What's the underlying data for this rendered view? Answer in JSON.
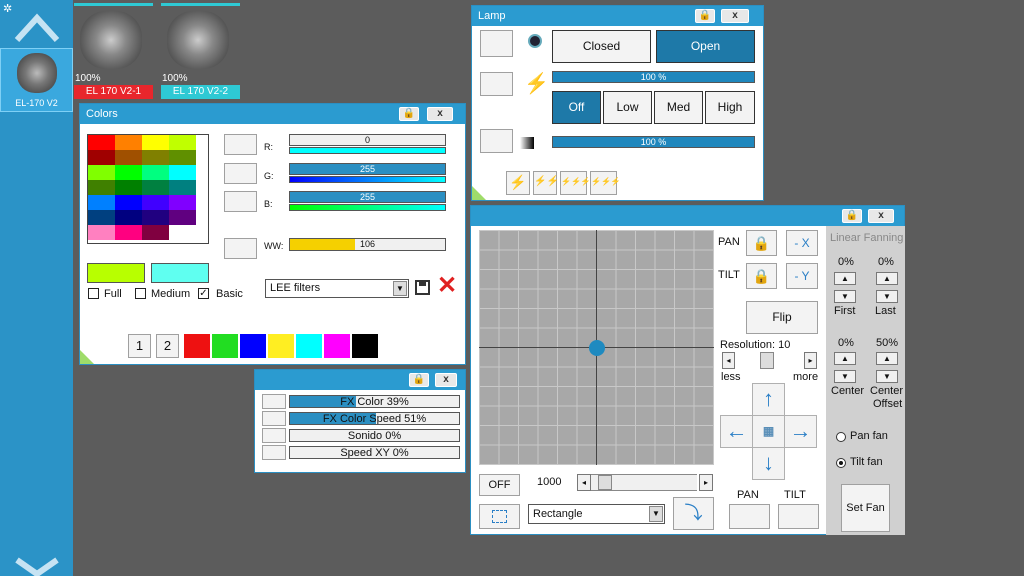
{
  "sidebar": {
    "fixture_label": "EL-170 V2"
  },
  "fixtures": [
    {
      "pct": "100%",
      "label": "EL 170 V2-1",
      "color": "#e8262c"
    },
    {
      "pct": "100%",
      "label": "EL 170 V2-2",
      "color": "#2ec9d4"
    }
  ],
  "colors_win": {
    "title": "Colors",
    "palette": [
      [
        "#ff0000",
        "#ff8000",
        "#ffff00",
        "#c0ff00"
      ],
      [
        "#a00000",
        "#a05000",
        "#808000",
        "#609000"
      ],
      [
        "#80ff00",
        "#00ff00",
        "#00ff80",
        "#00ffff"
      ],
      [
        "#408000",
        "#008000",
        "#008040",
        "#008080"
      ],
      [
        "#0080ff",
        "#0000ff",
        "#4000ff",
        "#8000ff"
      ],
      [
        "#004080",
        "#000080",
        "#200080",
        "#600080"
      ],
      [
        "#ff80c0",
        "#ff0080",
        "#800040",
        "#ffffff"
      ]
    ],
    "r": {
      "label": "R:",
      "value": "0",
      "pct": 0
    },
    "g": {
      "label": "G:",
      "value": "255",
      "pct": 100
    },
    "b": {
      "label": "B:",
      "value": "255",
      "pct": 100
    },
    "ww": {
      "label": "WW:",
      "value": "106",
      "pct": 42
    },
    "preview1": "#b8ff00",
    "preview2": "#5ffff0",
    "full_label": "Full",
    "medium_label": "Medium",
    "basic_label": "Basic",
    "filter_value": "LEE filters",
    "page1": "1",
    "page2": "2",
    "presets": [
      "#ee1111",
      "#22dd22",
      "#0000ff",
      "#ffee22",
      "#00ffff",
      "#ff00ff",
      "#000000"
    ]
  },
  "fx_win": {
    "rows": [
      {
        "label": "FX Color",
        "value": "39%",
        "pct": 39
      },
      {
        "label": "FX Color Speed",
        "value": "51%",
        "pct": 51
      },
      {
        "label": "Sonido",
        "value": "0%",
        "pct": 0
      },
      {
        "label": "Speed XY",
        "value": "0%",
        "pct": 0
      }
    ]
  },
  "lamp_win": {
    "title": "Lamp",
    "closed": "Closed",
    "open": "Open",
    "bar1": {
      "value": "100 %",
      "pct": 100
    },
    "off": "Off",
    "low": "Low",
    "med": "Med",
    "high": "High",
    "bar2": {
      "value": "100 %",
      "pct": 100
    }
  },
  "pos_win": {
    "pan": "PAN",
    "tilt": "TILT",
    "neg_x": "- X",
    "neg_y": "- Y",
    "flip": "Flip",
    "resolution": "Resolution: 10",
    "less": "less",
    "more": "more",
    "off": "OFF",
    "speed": "1000",
    "shape": "Rectangle",
    "pan_btn": "PAN",
    "tilt_btn": "TILT",
    "fanning_title": "Linear Fanning",
    "first_val": "0%",
    "last_val": "0%",
    "first": "First",
    "last": "Last",
    "center_val": "0%",
    "offset_val": "50%",
    "center": "Center",
    "center_offset1": "Center",
    "center_offset2": "Offset",
    "pan_fan": "Pan fan",
    "tilt_fan": "Tilt fan",
    "set_fan": "Set Fan",
    "dot_x": 0.5,
    "dot_y": 0.5
  }
}
